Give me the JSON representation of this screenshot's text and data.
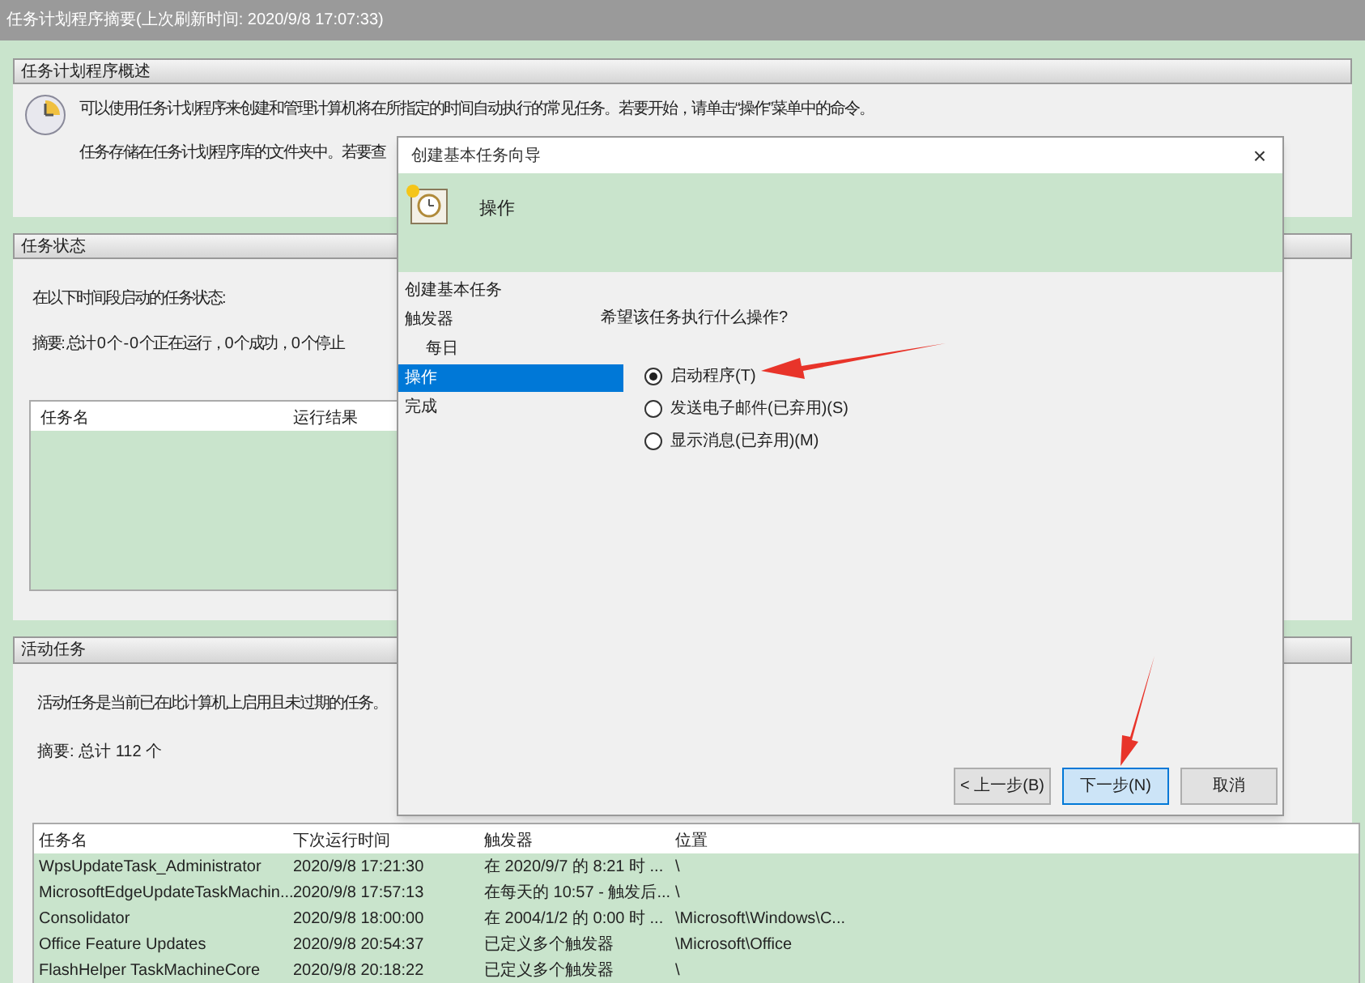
{
  "title": "任务计划程序摘要(上次刷新时间: 2020/9/8 17:07:33)",
  "overview": {
    "header": "任务计划程序概述",
    "lines": [
      "可以使用任务计划程序来创建和管理计算机将在所指定的时间自动执行的常见任务。若要开始，请单击“操作”菜单中的命令。",
      "任务存储在任务计划程序库的文件夹中。若要查"
    ]
  },
  "status": {
    "header": "任务状态",
    "text": "在以下时间段启动的任务状态:",
    "summary": "摘要: 总计 0 个 - 0 个正在运行，0 个成功，0 个停止",
    "columns": [
      "任务名",
      "运行结果"
    ]
  },
  "active": {
    "header": "活动任务",
    "text": "活动任务是当前已在此计算机上启用且未过期的任务。",
    "summary": "摘要: 总计 112 个",
    "columns": [
      "任务名",
      "下次运行时间",
      "触发器",
      "位置"
    ],
    "rows": [
      [
        "WpsUpdateTask_Administrator",
        "2020/9/8 17:21:30",
        "在 2020/9/7 的 8:21 时 ...",
        "\\"
      ],
      [
        "MicrosoftEdgeUpdateTaskMachin...",
        "2020/9/8 17:57:13",
        "在每天的 10:57 - 触发后...",
        "\\"
      ],
      [
        "Consolidator",
        "2020/9/8 18:00:00",
        "在 2004/1/2 的 0:00 时 ...",
        "\\Microsoft\\Windows\\C..."
      ],
      [
        "Office Feature Updates",
        "2020/9/8 20:54:37",
        "已定义多个触发器",
        "\\Microsoft\\Office"
      ],
      [
        "FlashHelper TaskMachineCore",
        "2020/9/8 20:18:22",
        "已定义多个触发器",
        "\\"
      ]
    ]
  },
  "dialog": {
    "title": "创建基本任务向导",
    "close": "×",
    "heading": "操作",
    "nav": [
      {
        "label": "创建基本任务",
        "selected": false
      },
      {
        "label": "触发器",
        "selected": false,
        "children": [
          {
            "label": "每日",
            "selected": false
          }
        ]
      },
      {
        "label": "操作",
        "selected": true
      },
      {
        "label": "完成",
        "selected": false
      }
    ],
    "question": "希望该任务执行什么操作?",
    "options": [
      {
        "label": "启动程序(T)",
        "selected": true
      },
      {
        "label": "发送电子邮件(已弃用)(S)",
        "selected": false
      },
      {
        "label": "显示消息(已弃用)(M)",
        "selected": false
      }
    ],
    "buttons": [
      {
        "label": "< 上一步(B)",
        "focused": false
      },
      {
        "label": "下一步(N)",
        "focused": true
      },
      {
        "label": "取消",
        "focused": false
      }
    ]
  }
}
